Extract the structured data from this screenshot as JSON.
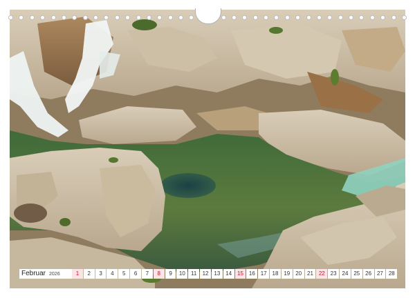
{
  "calendar": {
    "month": "Februar",
    "year": "2026",
    "days": [
      {
        "n": "1",
        "kind": "sun"
      },
      {
        "n": "2",
        "kind": "day"
      },
      {
        "n": "3",
        "kind": "day"
      },
      {
        "n": "4",
        "kind": "day"
      },
      {
        "n": "5",
        "kind": "day"
      },
      {
        "n": "6",
        "kind": "day"
      },
      {
        "n": "7",
        "kind": "sat"
      },
      {
        "n": "8",
        "kind": "sun"
      },
      {
        "n": "9",
        "kind": "day"
      },
      {
        "n": "10",
        "kind": "day"
      },
      {
        "n": "11",
        "kind": "day"
      },
      {
        "n": "12",
        "kind": "day"
      },
      {
        "n": "13",
        "kind": "day"
      },
      {
        "n": "14",
        "kind": "sat"
      },
      {
        "n": "15",
        "kind": "sun"
      },
      {
        "n": "16",
        "kind": "day"
      },
      {
        "n": "17",
        "kind": "day"
      },
      {
        "n": "18",
        "kind": "day"
      },
      {
        "n": "19",
        "kind": "day"
      },
      {
        "n": "20",
        "kind": "day"
      },
      {
        "n": "21",
        "kind": "sat"
      },
      {
        "n": "22",
        "kind": "sun"
      },
      {
        "n": "23",
        "kind": "day"
      },
      {
        "n": "24",
        "kind": "day"
      },
      {
        "n": "25",
        "kind": "day"
      },
      {
        "n": "26",
        "kind": "day"
      },
      {
        "n": "27",
        "kind": "sat"
      },
      {
        "n": "28",
        "kind": "day"
      }
    ],
    "colors": {
      "sunday_text": "#c0152f",
      "sunday_bg": "#fbe3e6"
    }
  },
  "photo": {
    "subject": "limestone-cascades-and-green-pool"
  }
}
